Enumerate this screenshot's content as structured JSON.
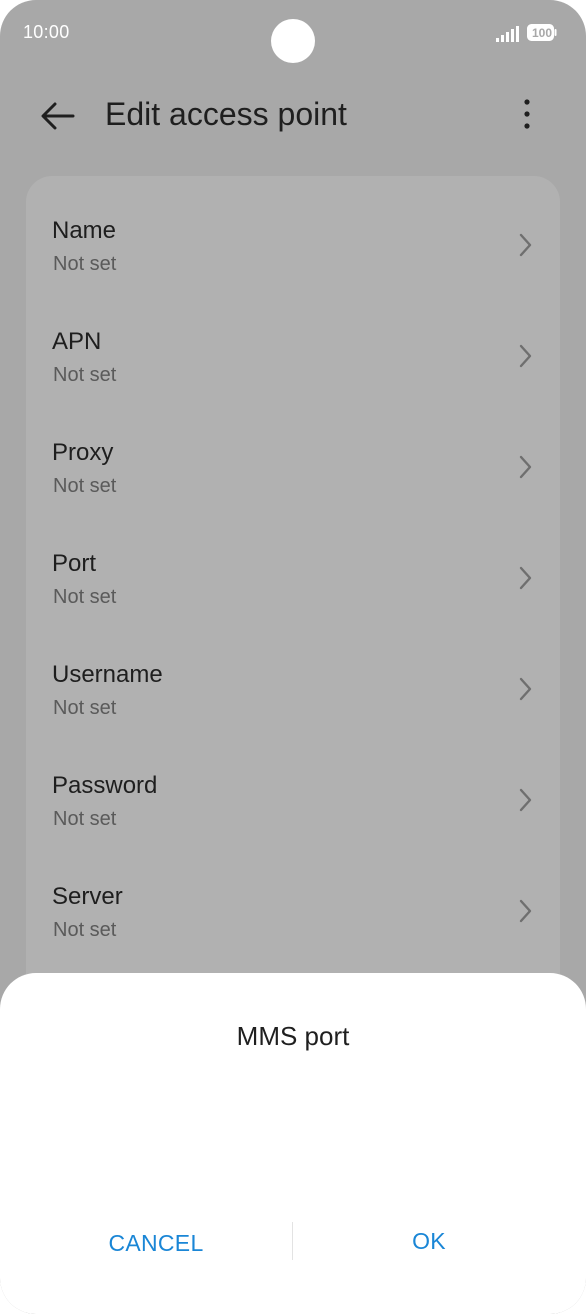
{
  "status_bar": {
    "time": "10:00",
    "battery": "100"
  },
  "header": {
    "title": "Edit access point"
  },
  "settings": [
    {
      "title": "Name",
      "value": "Not set"
    },
    {
      "title": "APN",
      "value": "Not set"
    },
    {
      "title": "Proxy",
      "value": "Not set"
    },
    {
      "title": "Port",
      "value": "Not set"
    },
    {
      "title": "Username",
      "value": "Not set"
    },
    {
      "title": "Password",
      "value": "Not set"
    },
    {
      "title": "Server",
      "value": "Not set"
    }
  ],
  "dialog": {
    "title": "MMS port",
    "input_value": "",
    "cancel_label": "CANCEL",
    "ok_label": "OK"
  },
  "colors": {
    "accent": "#1a86d6",
    "scrim_background": "#a8a8a8",
    "card_background": "#b1b1b1"
  }
}
